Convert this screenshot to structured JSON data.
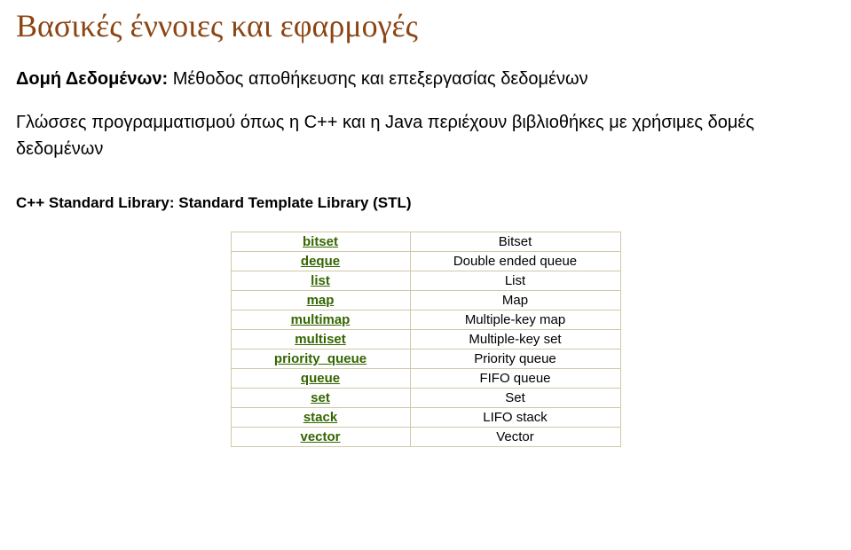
{
  "title": "Βασικές έννοιες και εφαρμογές",
  "subtitle_bold": "Δομή Δεδομένων:",
  "subtitle_rest": " Μέθοδος αποθήκευσης και επεξεργασίας δεδομένων",
  "paragraph": "Γλώσσες προγραμματισμού όπως η C++ και η Java περιέχουν βιβλιοθήκες με χρήσιμες δομές δεδομένων",
  "section_label": "C++ Standard Library: Standard Template Library (STL)",
  "table": {
    "rows": [
      {
        "left": "bitset",
        "right": "Bitset"
      },
      {
        "left": "deque",
        "right": "Double ended queue"
      },
      {
        "left": "list",
        "right": "List"
      },
      {
        "left": "map",
        "right": "Map"
      },
      {
        "left": "multimap",
        "right": "Multiple-key map"
      },
      {
        "left": "multiset",
        "right": "Multiple-key set"
      },
      {
        "left": "priority_queue",
        "right": "Priority queue"
      },
      {
        "left": "queue",
        "right": "FIFO queue"
      },
      {
        "left": "set",
        "right": "Set"
      },
      {
        "left": "stack",
        "right": "LIFO stack"
      },
      {
        "left": "vector",
        "right": "Vector"
      }
    ]
  }
}
